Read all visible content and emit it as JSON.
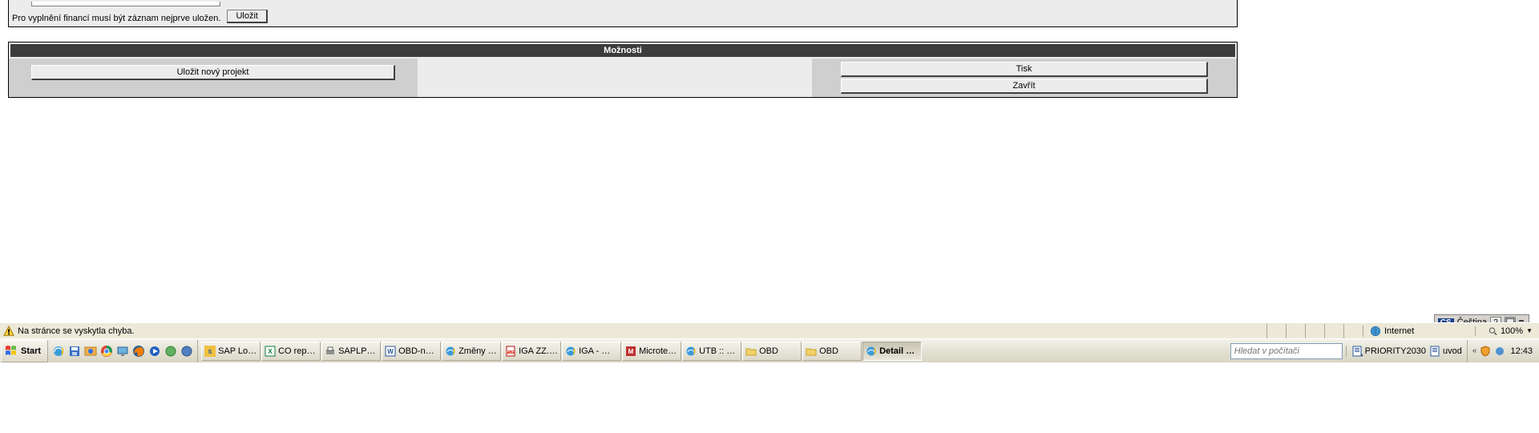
{
  "top": {
    "hint": "Pro vyplnění financí musí být záznam nejprve uložen.",
    "save_label": "Uložit"
  },
  "options": {
    "header": "Možnosti",
    "save_new_project": "Uložit nový projekt",
    "print": "Tisk",
    "close": "Zavřít"
  },
  "lang_bar": {
    "code": "CS",
    "name": "Čeština"
  },
  "ie_status": {
    "message": "Na stránce se vyskytla chyba.",
    "zone": "Internet",
    "zoom": "100%"
  },
  "taskbar": {
    "start": "Start",
    "search_placeholder": "Hledat v počítači",
    "tasks": [
      {
        "label": "SAP Logo...",
        "icon": "sap"
      },
      {
        "label": "CO repor...",
        "icon": "xls"
      },
      {
        "label": "SAPLPD -...",
        "icon": "prn"
      },
      {
        "label": "OBD-nav...",
        "icon": "doc"
      },
      {
        "label": "Změny tý...",
        "icon": "ie"
      },
      {
        "label": "IGA ZZ.p...",
        "icon": "pdf"
      },
      {
        "label": "IGA - Win...",
        "icon": "ie"
      },
      {
        "label": "Microtek ...",
        "icon": "mt"
      },
      {
        "label": "UTB :: Fa...",
        "icon": "ie"
      },
      {
        "label": "OBD",
        "icon": "fld"
      },
      {
        "label": "OBD",
        "icon": "fld"
      },
      {
        "label": "Detail pr...",
        "icon": "ie",
        "active": true
      }
    ],
    "desk": [
      {
        "label": "PRIORITY2030"
      },
      {
        "label": "uvod"
      }
    ],
    "clock": "12:43"
  }
}
